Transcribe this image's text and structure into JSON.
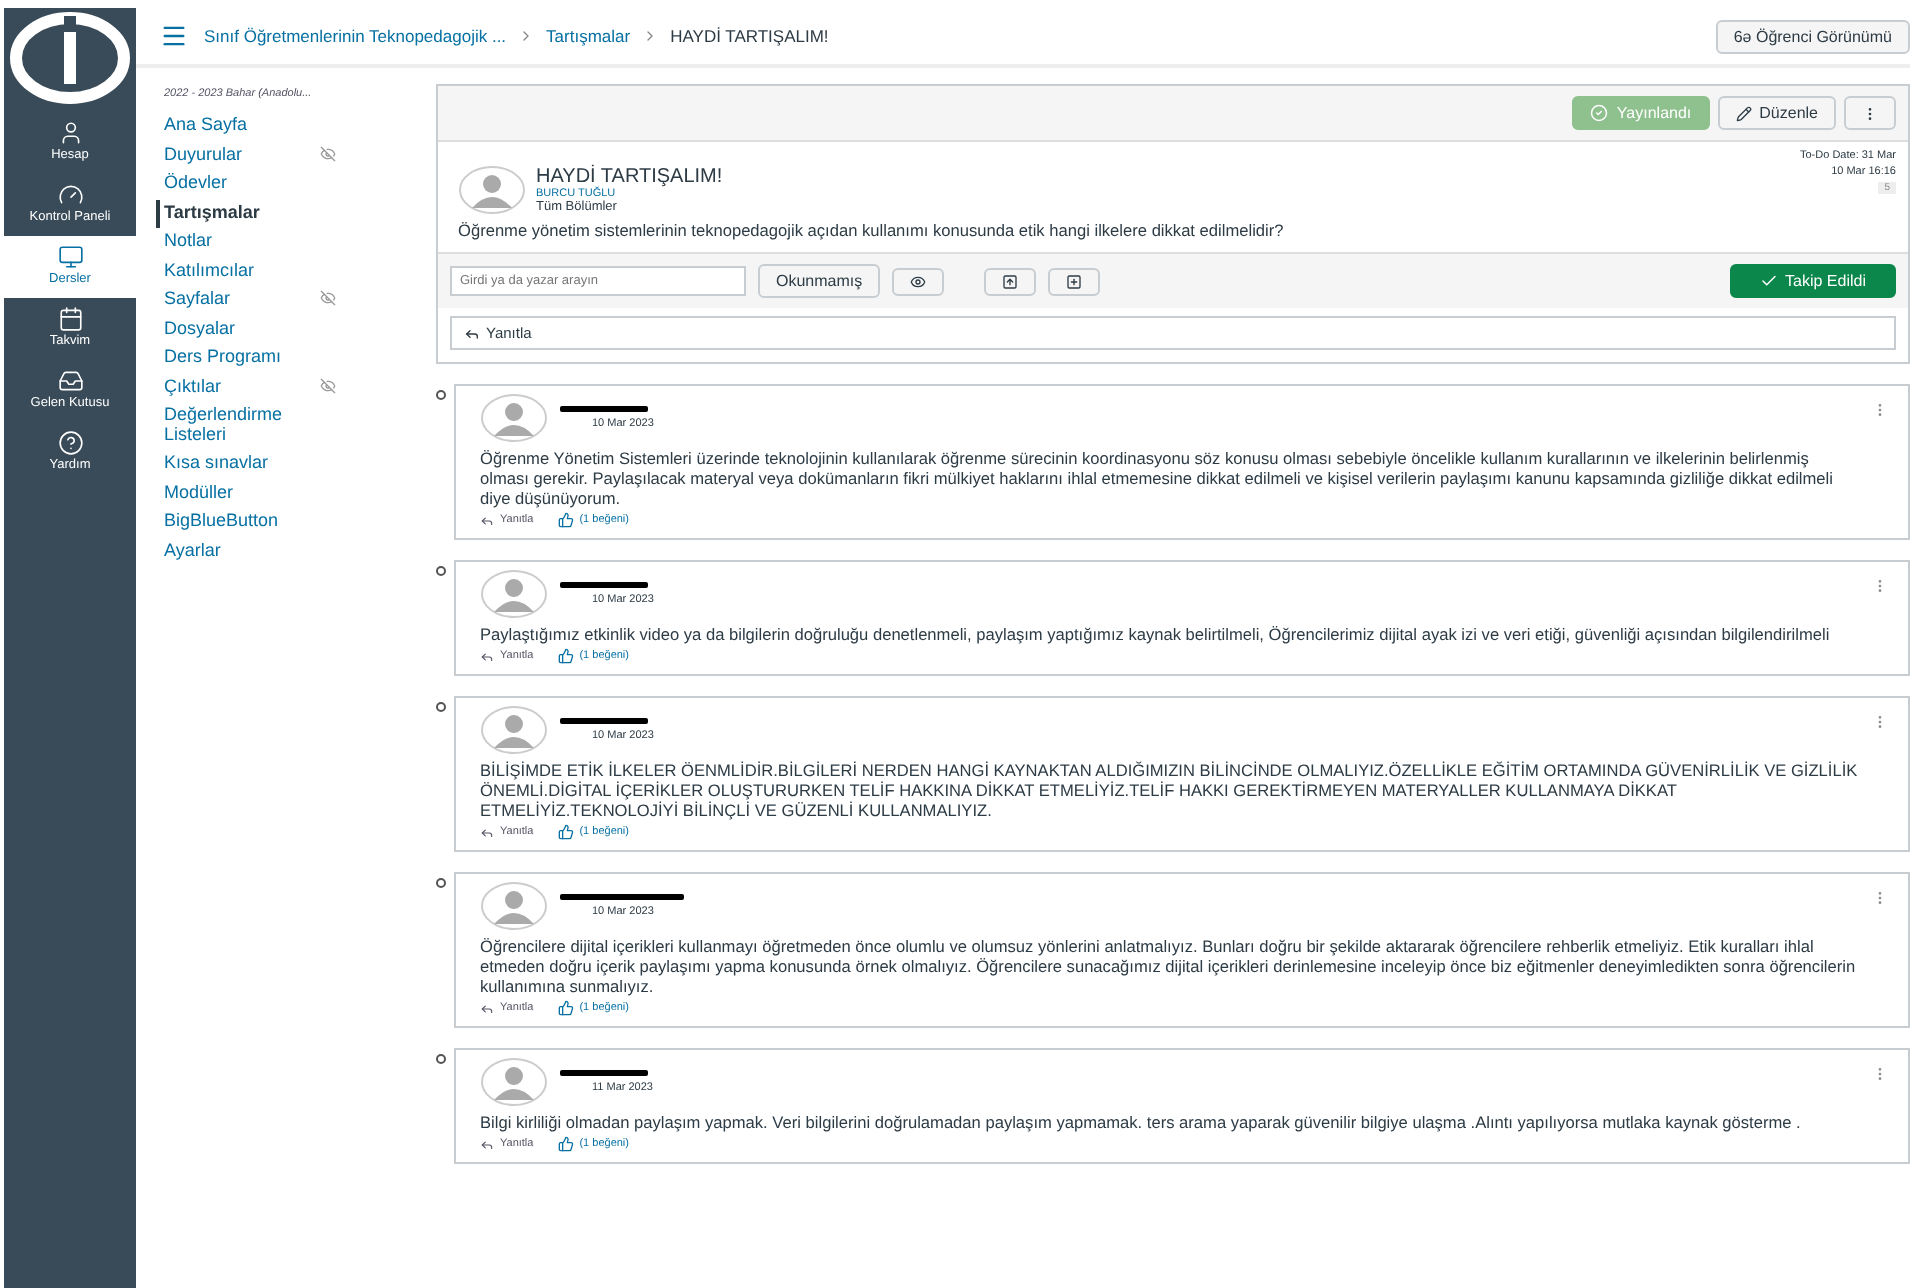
{
  "global_nav": [
    {
      "kind": "account",
      "label": "Hesap",
      "selected": false
    },
    {
      "kind": "dashboard",
      "label": "Kontrol Paneli",
      "selected": false
    },
    {
      "kind": "courses",
      "label": "Dersler",
      "selected": true
    },
    {
      "kind": "calendar",
      "label": "Takvim",
      "selected": false
    },
    {
      "kind": "inbox",
      "label": "Gelen Kutusu",
      "selected": false
    },
    {
      "kind": "help",
      "label": "Yardım",
      "selected": false
    }
  ],
  "breadcrumb": [
    "Sınıf Öğretmenlerinin Teknopedagojik ...",
    "Tartışmalar",
    "HAYDİ TARTIŞALIM!"
  ],
  "student_view_button": "6ə Öğrenci Görünümü",
  "course_nav": {
    "term": "2022 - 2023 Bahar (Anadolu...",
    "items": [
      {
        "label": "Ana Sayfa",
        "selected": false,
        "hidden": false
      },
      {
        "label": "Duyurular",
        "selected": false,
        "hidden": true
      },
      {
        "label": "Ödevler",
        "selected": false,
        "hidden": false
      },
      {
        "label": "Tartışmalar",
        "selected": true,
        "hidden": false
      },
      {
        "label": "Notlar",
        "selected": false,
        "hidden": false
      },
      {
        "label": "Katılımcılar",
        "selected": false,
        "hidden": false
      },
      {
        "label": "Sayfalar",
        "selected": false,
        "hidden": true
      },
      {
        "label": "Dosyalar",
        "selected": false,
        "hidden": false
      },
      {
        "label": "Ders Programı",
        "selected": false,
        "hidden": false
      },
      {
        "label": "Çıktılar",
        "selected": false,
        "hidden": true
      },
      {
        "label": "Değerlendirme Listeleri",
        "selected": false,
        "hidden": false
      },
      {
        "label": "Kısa sınavlar",
        "selected": false,
        "hidden": false
      },
      {
        "label": "Modüller",
        "selected": false,
        "hidden": false
      },
      {
        "label": "BigBlueButton",
        "selected": false,
        "hidden": false
      },
      {
        "label": "Ayarlar",
        "selected": false,
        "hidden": false
      }
    ]
  },
  "topic": {
    "publish_button": "Yayınlandı",
    "edit_button": "Düzenle",
    "todo_date": "To-Do Date: 31 Mar",
    "title": "HAYDİ TARTIŞALIM!",
    "author": "BURCU TUĞLU",
    "section": "Tüm Bölümler",
    "date": "10 Mar 16:16",
    "count": "5",
    "body": "Öğrenme yönetim sistemlerinin teknopedagojik açıdan kullanımı konusunda etik hangi ilkelere dikkat edilmelidir?"
  },
  "toolbar": {
    "search_placeholder": "Girdi ya da yazar arayın",
    "unread_button": "Okunmamış",
    "follow_button": "Takip Edildi"
  },
  "reply_box": "Yanıtla",
  "entries": [
    {
      "date": "10 Mar 2023",
      "body": "Öğrenme Yönetim Sistemleri üzerinde teknolojinin kullanılarak öğrenme sürecinin koordinasyonu söz konusu olması sebebiyle öncelikle kullanım kurallarının ve ilkelerinin belirlenmiş olması gerekir. Paylaşılacak materyal veya dokümanların fikri mülkiyet haklarını ihlal etmemesine dikkat edilmeli ve kişisel verilerin paylaşımı kanunu kapsamında gizliliğe dikkat edilmeli diye düşünüyorum.",
      "reply": "Yanıtla",
      "likes": "(1 beğeni)"
    },
    {
      "date": "10 Mar 2023",
      "body": "Paylaştığımız etkinlik video ya da bilgilerin doğruluğu denetlenmeli, paylaşım yaptığımız kaynak belirtilmeli, Öğrencilerimiz dijital ayak izi ve veri etiği, güvenliği açısından bilgilendirilmeli",
      "reply": "Yanıtla",
      "likes": "(1 beğeni)"
    },
    {
      "date": "10 Mar 2023",
      "body": "BİLİŞİMDE ETİK İLKELER ÖENMLİDİR.BİLGİLERİ NERDEN HANGİ KAYNAKTAN ALDIĞIMIZIN BİLİNCİNDE OLMALIYIZ.ÖZELLİKLE EĞİTİM ORTAMINDA GÜVENİRLİLİK VE GİZLİLİK ÖNEMLİ.DİGİTAL İÇERİKLER OLUŞTURURKEN TELİF HAKKINA DİKKAT ETMELİYİZ.TELİF HAKKI GEREKTİRMEYEN MATERYALLER KULLANMAYA DİKKAT ETMELİYİZ.TEKNOLOJİYİ BİLİNÇLİ VE GÜZENLİ KULLANMALIYIZ.",
      "reply": "Yanıtla",
      "likes": "(1 beğeni)"
    },
    {
      "date": "10 Mar 2023",
      "body": "Öğrencilere dijital içerikleri kullanmayı öğretmeden önce olumlu ve olumsuz yönlerini anlatmalıyız. Bunları doğru bir şekilde aktararak öğrencilere rehberlik etmeliyiz. Etik kuralları ihlal etmeden doğru içerik paylaşımı yapma konusunda örnek olmalıyız. Öğrencilere sunacağımız dijital içerikleri derinlemesine inceleyip önce biz eğitmenler deneyimledikten sonra öğrencilerin kullanımına sunmalıyız.",
      "reply": "Yanıtla",
      "likes": "(1 beğeni)"
    },
    {
      "date": "11 Mar 2023",
      "body": "Bilgi kirliliği olmadan paylaşım yapmak. Veri bilgilerini doğrulamadan paylaşım yapmamak. ters arama yaparak güvenilir bilgiye ulaşma .Alıntı yapılıyorsa mutlaka kaynak gösterme .",
      "reply": "Yanıtla",
      "likes": "(1 beğeni)"
    }
  ]
}
